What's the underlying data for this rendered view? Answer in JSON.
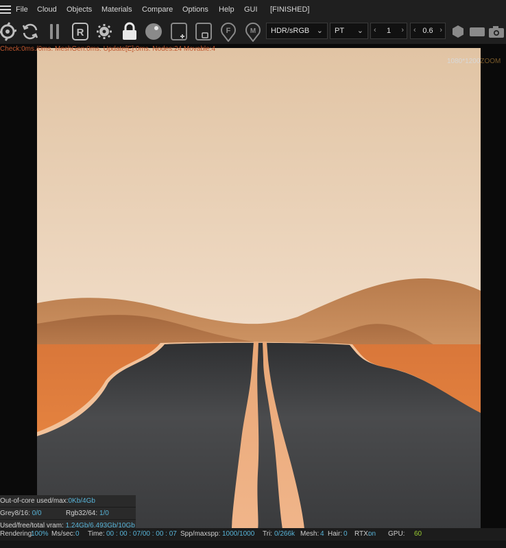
{
  "menu": {
    "items": [
      "File",
      "Cloud",
      "Objects",
      "Materials",
      "Compare",
      "Options",
      "Help",
      "GUI"
    ],
    "status": "[FINISHED]"
  },
  "toolbar": {
    "icons": [
      "octane-logo-icon",
      "reload-icon",
      "pause-icon",
      "restart-icon",
      "settings-gear-icon",
      "lock-icon",
      "sphere-icon",
      "add-region-icon",
      "focus-region-icon",
      "focus-picker-icon",
      "material-picker-icon"
    ],
    "render_letter": "R",
    "focus_letter": "F",
    "material_letter": "M",
    "color_space": "HDR/sRGB",
    "kernel": "PT",
    "spinner1_value": "1",
    "spinner2_value": "0.6",
    "spinner_left": "‹",
    "spinner_right": "›",
    "dropdown_arrow": "⌄",
    "extra_icons": [
      "hexagon-icon",
      "region-icon",
      "camera-icon"
    ]
  },
  "viewport": {
    "stats_line": "Check:0ms./0ms. MeshGen:0ms. Update[E]:0ms. Nodes:24 Movable:4",
    "resolution": "1080*1200",
    "zoom_label": "ZOOM"
  },
  "info_panel": {
    "out_of_core_label": "Out-of-core used/max:",
    "out_of_core_value": "0Kb/4Gb",
    "grey_label": "Grey8/16:",
    "grey_value": "0/0",
    "rgb_label": "Rgb32/64:",
    "rgb_value": "1/0",
    "vram_label": "Used/free/total vram:",
    "vram_value": "1.24Gb/6.493Gb/10Gb"
  },
  "statusbar": {
    "rendering_label": "Rendering:",
    "rendering_value": "100%",
    "mssec_label": "Ms/sec:",
    "mssec_value": "0",
    "time_label": "Time:",
    "time_value": "00 : 00 : 07/00 : 00 : 07",
    "spp_label": "Spp/maxspp:",
    "spp_value": "1000/1000",
    "tri_label": "Tri:",
    "tri_value": "0/266k",
    "mesh_label": "Mesh:",
    "mesh_value": "4",
    "hair_label": "Hair:",
    "hair_value": "0",
    "rtx_label": "RTX:",
    "rtx_value": "on",
    "gpu_label": "GPU:",
    "gpu_value": "60"
  },
  "colors": {
    "accent": "#58b4d8",
    "gpu_value": "#9acd32",
    "stats": "#c0572e",
    "sky_top": "#e4c6a6",
    "sand": "#c98a55",
    "ground": "#e88a40",
    "road": "#3c3d3f",
    "road_line": "#efb488"
  }
}
